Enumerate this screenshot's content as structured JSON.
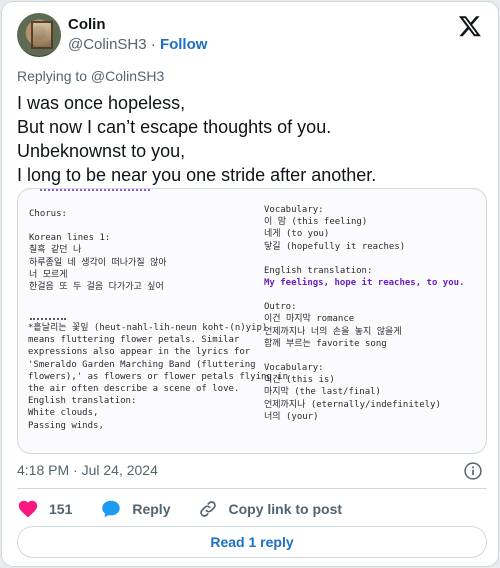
{
  "author": {
    "name": "Colin",
    "handle": "@ColinSH3",
    "separator": "·",
    "follow_label": "Follow"
  },
  "replying_to": "Replying to @ColinSH3",
  "tweet_lines": [
    "I was once hopeless,",
    "But now I can’t escape thoughts of you.",
    "Unbeknownst to you,",
    "I long to be near you one stride after another."
  ],
  "media": {
    "left_column": [
      "Chorus:",
      "",
      "Korean lines 1:",
      "칠흑 같던 나",
      "하루종일 네 생각이 떠나가질 않아",
      "너 모르게",
      "한걸음 또 두 걸음 다가가고 싶어"
    ],
    "note": [
      "*흩날리는 꽃잎 (heut-nahl-lih-neun koht-(n)yip)",
      "means fluttering flower petals. Similar",
      "expressions also appear in the lyrics for",
      "'Smeraldo Garden Marching Band (fluttering",
      "flowers),' as flowers or flower petals flying in",
      "the air often describe a scene of love.",
      "",
      "English translation:"
    ],
    "note_purple": [
      "White clouds,",
      "Passing winds,"
    ],
    "right_column_top": [
      "Vocabulary:",
      "이 맘 (this feeling)",
      "네게 (to you)",
      "닿길 (hopefully it reaches)",
      "",
      "English translation:"
    ],
    "right_translation": "My feelings, hope it reaches, to you.",
    "right_column_bottom": [
      "",
      "Outro:",
      " 이건 마지막 romance",
      " 언제까지나 너의 손을 놓지 않을게",
      " 함께 부르는 favorite song",
      "",
      " Vocabulary:",
      " 이건 (this is)",
      " 마지막 (the last/final)",
      " 언제까지나 (eternally/indefinitely)",
      " 너의 (your)"
    ]
  },
  "timestamp": "4:18 PM · Jul 24, 2024",
  "actions": {
    "like_count": "151",
    "reply_label": "Reply",
    "copy_label": "Copy link to post"
  },
  "read_reply_label": "Read 1 reply",
  "colors": {
    "link_blue": "#1d6fc4",
    "heart_red": "#f91880",
    "reply_blue": "#1d9bf0",
    "muted": "#536471",
    "purple_text": "#7a2fcf"
  },
  "icons": {
    "logo": "x-logo-icon",
    "like": "heart-icon",
    "reply": "speech-bubble-icon",
    "copy": "link-icon",
    "info": "info-icon"
  }
}
